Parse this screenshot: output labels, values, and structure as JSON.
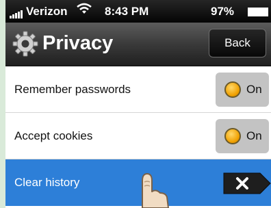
{
  "status_bar": {
    "carrier": "Verizon",
    "time": "8:43 PM",
    "battery": "97%"
  },
  "nav": {
    "title": "Privacy",
    "back_label": "Back",
    "icon": "gear-icon"
  },
  "settings": [
    {
      "label": "Remember passwords",
      "toggle_label": "On"
    },
    {
      "label": "Accept cookies",
      "toggle_label": "On"
    }
  ],
  "clear_row": {
    "label": "Clear history",
    "icon": "close-icon"
  },
  "colors": {
    "highlight": "#2d7fd8",
    "toggle_knob": "#f0a000"
  }
}
